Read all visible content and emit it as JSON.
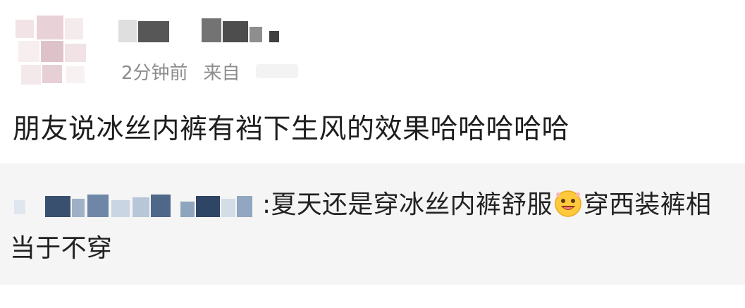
{
  "post": {
    "time": "2分钟前",
    "source_label": "来自",
    "content": "朋友说冰丝内裤有裆下生风的效果哈哈哈哈哈"
  },
  "comment": {
    "separator": ":",
    "text_part1": "夏天还是穿冰丝内裤舒服",
    "emoji": "grinning-face-emoji",
    "text_part2": "穿西装裤相当于不穿"
  },
  "colors": {
    "meta_text": "#8c8c8c",
    "comment_bg": "#f5f5f5",
    "main_text": "#1e1e1e"
  }
}
